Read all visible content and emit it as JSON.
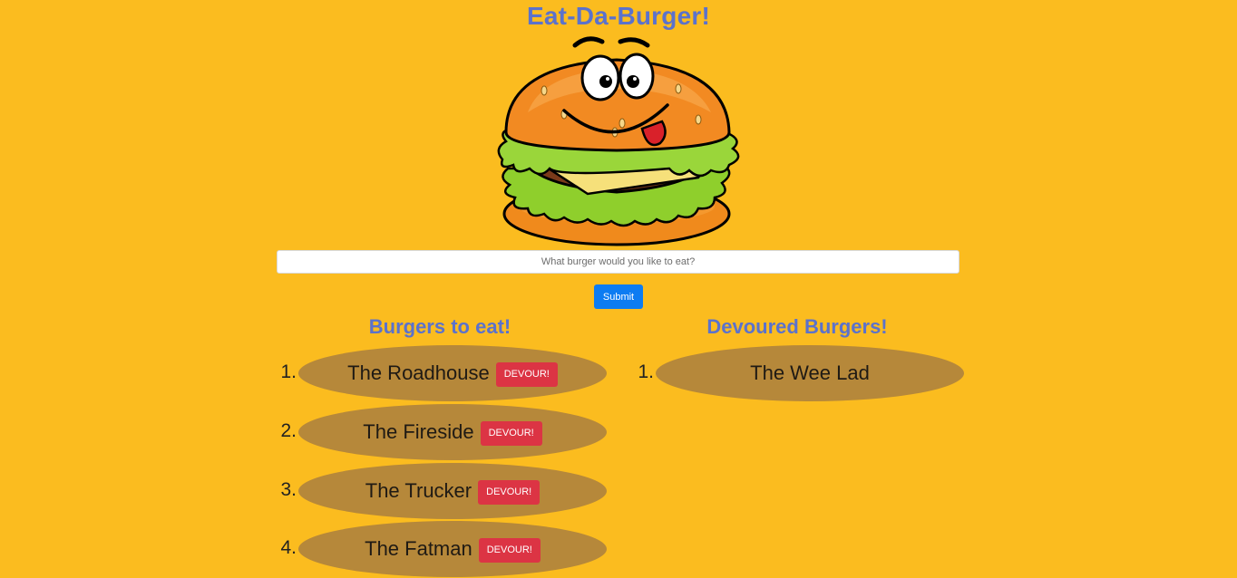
{
  "header": {
    "title": "Eat-Da-Burger!"
  },
  "form": {
    "placeholder": "What burger would you like to eat?",
    "submit_label": "Submit"
  },
  "to_eat": {
    "heading": "Burgers to eat!",
    "button_label": "DEVOUR!",
    "items": [
      {
        "num": "1.",
        "name": "The Roadhouse"
      },
      {
        "num": "2.",
        "name": "The Fireside"
      },
      {
        "num": "3.",
        "name": "The Trucker"
      },
      {
        "num": "4.",
        "name": "The Fatman"
      }
    ]
  },
  "devoured": {
    "heading": "Devoured Burgers!",
    "items": [
      {
        "num": "1.",
        "name": "The Wee Lad"
      }
    ]
  },
  "colors": {
    "background": "#fbbc1f",
    "heading": "#5b72cc",
    "submit": "#0d7cf2",
    "devour": "#dc3444",
    "oval": "#b6883a"
  }
}
